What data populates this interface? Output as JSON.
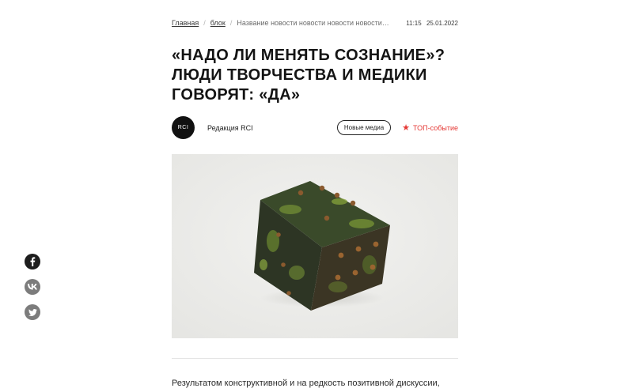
{
  "breadcrumbs": {
    "home": "Главная",
    "section": "блок",
    "current": "Название новости новости новости новости…",
    "time": "11:15",
    "date": "25.01.2022"
  },
  "article": {
    "title": "«Надо ли менять сознание»? Люди творчества и медики говорят: «да»",
    "lead": "Результатом конструктивной и на редкость позитивной дискуссии,"
  },
  "author": {
    "avatar_text": "RCI",
    "name": "Редакция RCI"
  },
  "tag_label": "Новые медиа",
  "top_event": {
    "icon": "star-icon",
    "label": "ТОП-событие"
  },
  "share_icons": [
    "facebook-icon",
    "vk-icon",
    "twitter-icon"
  ],
  "colors": {
    "accent": "#e53935",
    "text": "#1a1a1a",
    "muted": "#6b6b6b",
    "share_primary": "#1d1d1d",
    "share_secondary": "#7c7c7c"
  }
}
